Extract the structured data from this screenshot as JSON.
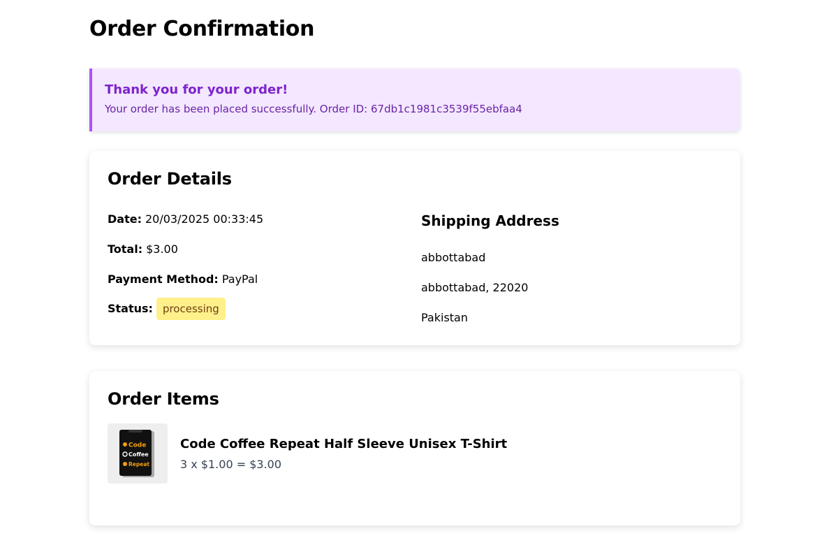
{
  "page": {
    "title": "Order Confirmation"
  },
  "alert": {
    "title": "Thank you for your order!",
    "message": "Your order has been placed successfully. Order ID: 67db1c1981c3539f55ebfaa4"
  },
  "order_details": {
    "title": "Order Details",
    "date_label": "Date:",
    "date_value": "20/03/2025 00:33:45",
    "total_label": "Total:",
    "total_value": "$3.00",
    "payment_label": "Payment Method:",
    "payment_value": "PayPal",
    "status_label": "Status:",
    "status_value": "processing",
    "shipping": {
      "title": "Shipping Address",
      "lines": [
        "abbottabad",
        "abbottabad, 22020",
        "Pakistan"
      ]
    }
  },
  "order_items": {
    "title": "Order Items",
    "items": [
      {
        "name": "Code Coffee Repeat Half Sleeve Unisex T-Shirt",
        "price_line": "3 x $1.00 = $3.00",
        "thumb_text": [
          "Code",
          "Coffee",
          "Repeat"
        ]
      }
    ]
  },
  "colors": {
    "alert_bg": "#f3e8ff",
    "alert_border": "#a855f7",
    "alert_title": "#7e22ce",
    "status_bg": "#fef08a",
    "shirt_orange": "#f59e0b"
  }
}
